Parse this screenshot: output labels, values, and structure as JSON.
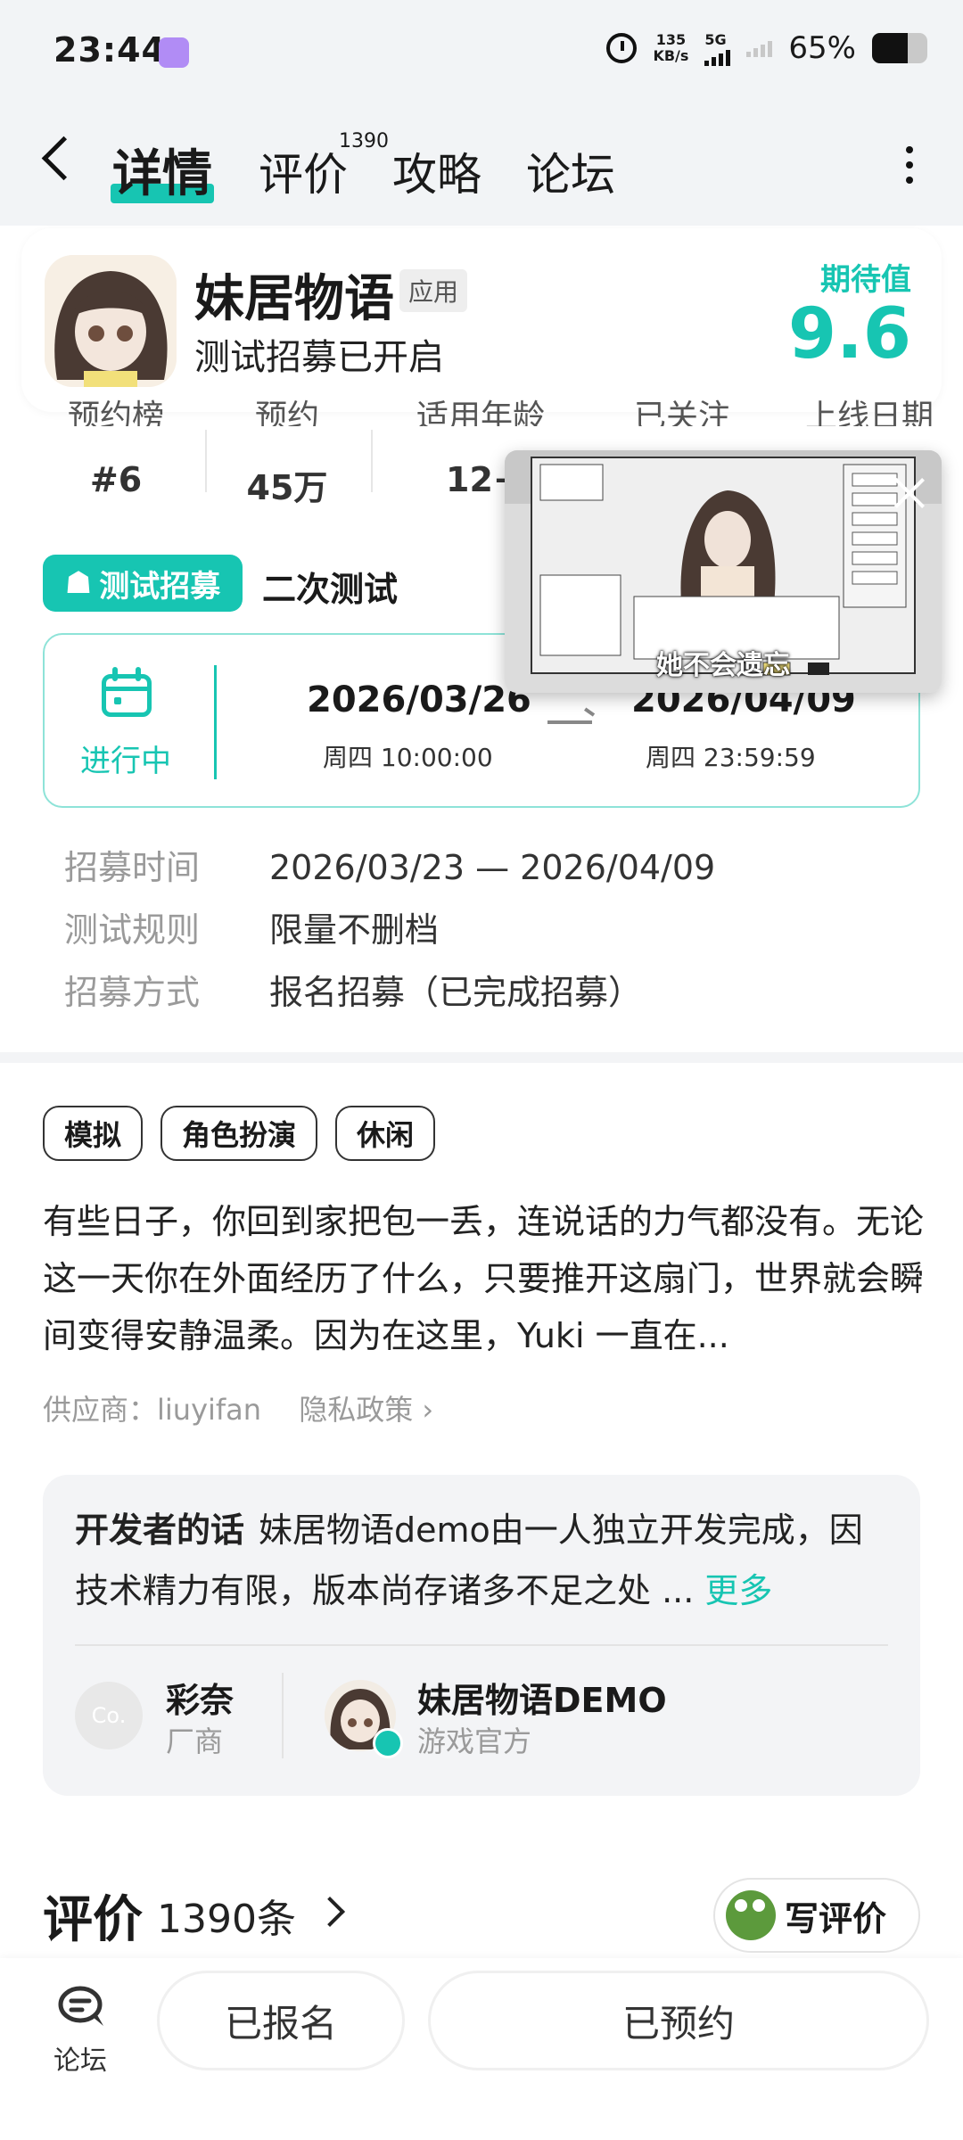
{
  "status_bar": {
    "time": "23:44",
    "net_speed_value": "135",
    "net_speed_unit": "KB/s",
    "network": "5G",
    "battery": "65%",
    "battery_level": 0.65
  },
  "nav": {
    "tabs": [
      "详情",
      "评价",
      "攻略",
      "论坛"
    ],
    "review_badge": "1390"
  },
  "app": {
    "name": "妹居物语",
    "type_badge": "应用",
    "subtitle": "测试招募已开启",
    "expect_label": "期待值",
    "expect_score": "9.6"
  },
  "stats": [
    {
      "label": "预约榜",
      "value": "#6"
    },
    {
      "label": "预约",
      "value": "45万"
    },
    {
      "label": "适用年龄",
      "value": "12+"
    },
    {
      "label": "已关注",
      "value": ""
    },
    {
      "label": "上线日期",
      "value": ""
    }
  ],
  "pip": {
    "caption": "她不会遗忘"
  },
  "test": {
    "tag": "测试招募",
    "phase": "二次测试",
    "status": "进行中",
    "start_date": "2026/03/26",
    "start_time": "周四  10:00:00",
    "end_date": "2026/04/09",
    "end_time": "周四  23:59:59"
  },
  "info": [
    {
      "key": "招募时间",
      "value": "2026/03/23 — 2026/04/09"
    },
    {
      "key": "测试规则",
      "value": "限量不删档"
    },
    {
      "key": "招募方式",
      "value": "报名招募（已完成招募）"
    }
  ],
  "tags": [
    "模拟",
    "角色扮演",
    "休闲"
  ],
  "description": "有些日子，你回到家把包一丢，连说话的力气都没有。无论这一天你在外面经历了什么，只要推开这扇门，世界就会瞬间变得安静温柔。因为在这里，Yuki 一直在...",
  "supplier": {
    "text": "供应商：liuyifan",
    "privacy": "隐私政策 ›"
  },
  "developer": {
    "heading": "开发者的话",
    "text": "妹居物语demo由一人独立开发完成，因技术精力有限，版本尚存诸多不足之处 ...",
    "more": "更多",
    "company_avatar": "Co.",
    "company_name": "彩奈",
    "company_role": "厂商",
    "official_name": "妹居物语DEMO",
    "official_role": "游戏官方"
  },
  "reviews": {
    "title": "评价",
    "count": "1390条",
    "write": "写评价"
  },
  "bottom": {
    "forum": "论坛",
    "signed": "已报名",
    "reserved": "已预约"
  },
  "colors": {
    "accent": "#17c5b2",
    "header_bg": "#f2f4f6"
  }
}
